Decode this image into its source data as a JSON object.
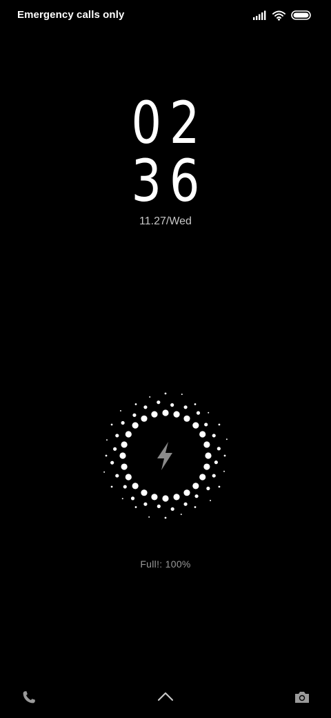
{
  "status_bar": {
    "carrier_text": "Emergency calls only",
    "icons": [
      "signal-icon",
      "wifi-icon",
      "battery-icon"
    ]
  },
  "clock": {
    "hours": "02",
    "minutes": "36",
    "date": "11.27/Wed"
  },
  "charging": {
    "status_text": "Full!: 100%",
    "level_percent": 100,
    "icon": "lightning-bolt-icon"
  },
  "bottom_bar": {
    "left_icon": "phone-icon",
    "center_icon": "chevron-up-icon",
    "right_icon": "camera-icon"
  },
  "colors": {
    "background": "#000000",
    "primary_text": "#ffffff",
    "secondary_text": "#c8c8c8",
    "muted_text": "#9a9a9a",
    "bolt": "#8a8a8a"
  }
}
